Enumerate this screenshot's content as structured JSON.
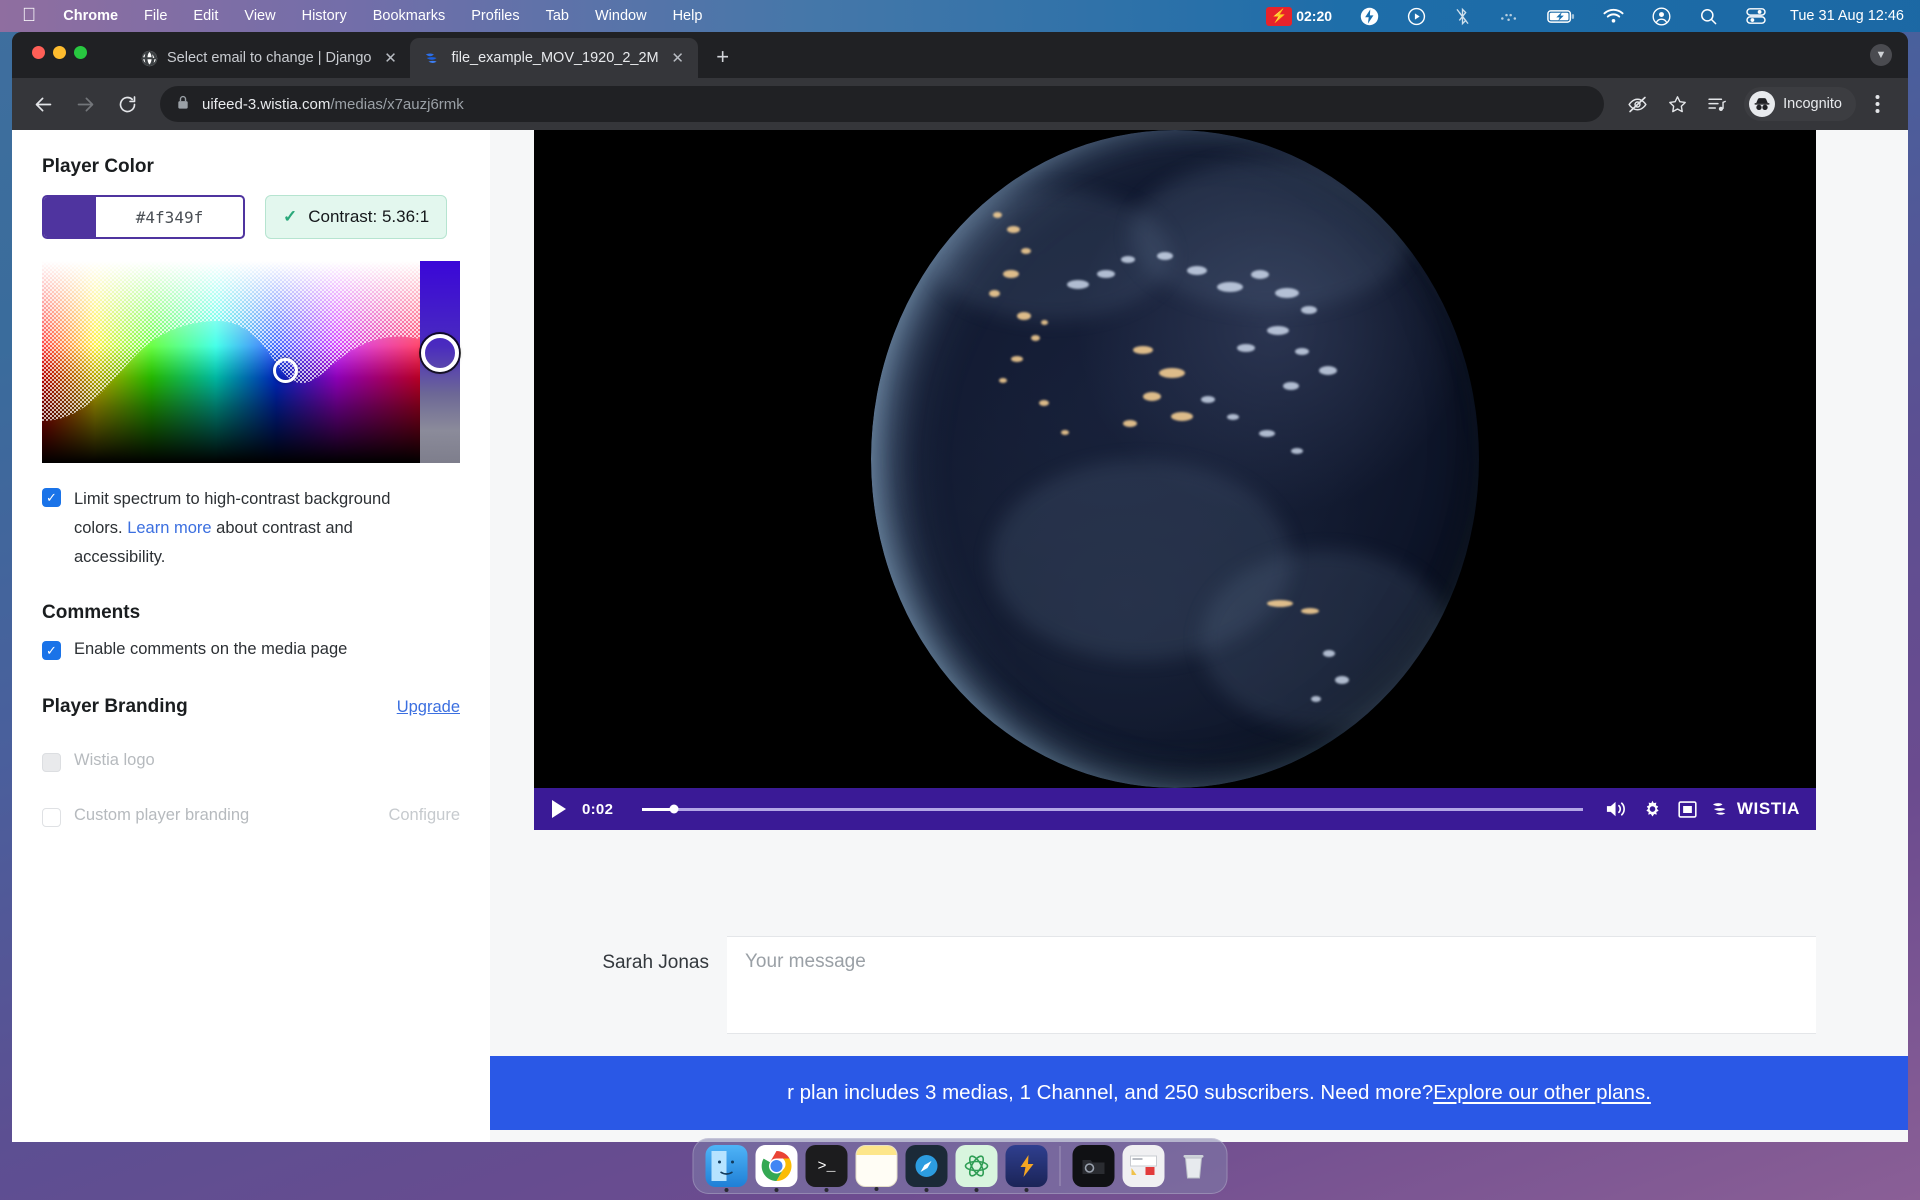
{
  "menubar": {
    "apple": "apple-logo",
    "items": [
      "Chrome",
      "File",
      "Edit",
      "View",
      "History",
      "Bookmarks",
      "Profiles",
      "Tab",
      "Window",
      "Help"
    ],
    "recording_time": "02:20",
    "status_icons": [
      "bolt-icon",
      "screen-record-icon",
      "bluetooth-off-icon",
      "dots-icon",
      "battery-charging-icon",
      "wifi-icon",
      "account-icon",
      "search-icon",
      "control-center-icon"
    ],
    "datetime": "Tue 31 Aug  12:46"
  },
  "browser": {
    "tabs": [
      {
        "title": "Select email to change | Django",
        "favicon": "globe-icon",
        "active": false
      },
      {
        "title": "file_example_MOV_1920_2_2M",
        "favicon": "wistia-icon",
        "active": true
      }
    ],
    "new_tab_label": "+",
    "toolbar": {
      "back": "back-arrow",
      "forward": "forward-arrow",
      "reload": "reload-icon",
      "lock": "lock-icon",
      "url_domain": "uifeed-3.wistia.com",
      "url_path": "/medias/x7auzj6rmk",
      "right_icons": [
        "eye-off-icon",
        "star-icon",
        "reading-list-icon"
      ],
      "profile_label": "Incognito",
      "menu": "three-dot-menu"
    }
  },
  "sidebar": {
    "player_color": {
      "title": "Player Color",
      "hex_value": "#4f349f",
      "swatch_color": "#4f349f",
      "contrast_label": "Contrast: 5.36:1",
      "contrast_check": "✓"
    },
    "limit_spectrum": {
      "checked": true,
      "text_before": "Limit spectrum to high-contrast background colors. ",
      "link": "Learn more",
      "text_after": " about contrast and accessibility."
    },
    "comments": {
      "title": "Comments",
      "checkbox_label": "Enable comments on the media page",
      "checked": true
    },
    "player_branding": {
      "title": "Player Branding",
      "upgrade_label": "Upgrade",
      "wistia_logo_label": "Wistia logo",
      "custom_branding_label": "Custom player branding",
      "configure_label": "Configure"
    }
  },
  "player": {
    "current_time": "0:02",
    "play_icon": "play-icon",
    "volume_icon": "volume-icon",
    "settings_icon": "gear-icon",
    "fullscreen_icon": "fullscreen-icon",
    "brand": "WISTIA",
    "progress_percent": 3.4,
    "bar_color": "#3a1a96"
  },
  "comment": {
    "author": "Sarah Jonas",
    "placeholder": "Your message",
    "value": ""
  },
  "banner": {
    "text": "r plan includes 3 medias, 1 Channel, and 250 subscribers. Need more? ",
    "link": "Explore our other plans.",
    "color": "#2a58e6"
  },
  "dock": {
    "items": [
      "finder-icon",
      "chrome-icon",
      "terminal-icon",
      "notes-icon",
      "preview-icon",
      "atom-icon",
      "wistia-bolt-icon",
      "folder-icon",
      "screenshot-icon",
      "trash-icon"
    ]
  }
}
